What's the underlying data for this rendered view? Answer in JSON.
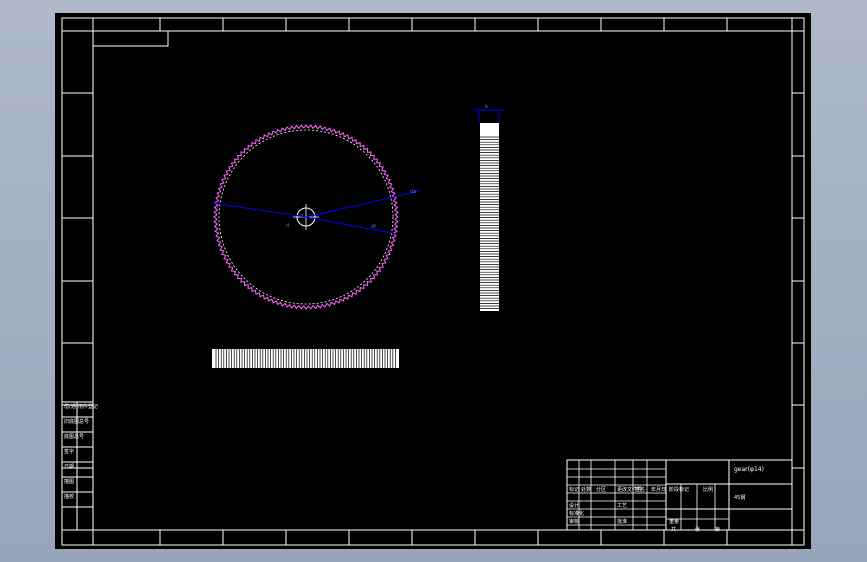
{
  "colors": {
    "background": "#000000",
    "frame": "#ffffff",
    "gear_outline": "#ff66ff",
    "dimension": "#0000ff",
    "window_bg": "#a4b0c2"
  },
  "drawing": {
    "title_block": {
      "drawing_name": "gear(φ14)",
      "material": "45钢",
      "labels": [
        "标记",
        "处数",
        "分区",
        "更改文件号",
        "签名",
        "年月日",
        "设计",
        "标准化",
        "审核",
        "工艺",
        "批准",
        "阶段标记",
        "重量",
        "比例",
        "共",
        "张",
        "第"
      ]
    },
    "side_labels": [
      "借(通)用件登记",
      "旧底图总号",
      "底图总号",
      "签字",
      "日期",
      "描图",
      "描校"
    ],
    "dimensions": {
      "width_label": "b",
      "tip_diameter_label": "da",
      "root_diameter_label": "df",
      "bore_label": "d"
    }
  }
}
